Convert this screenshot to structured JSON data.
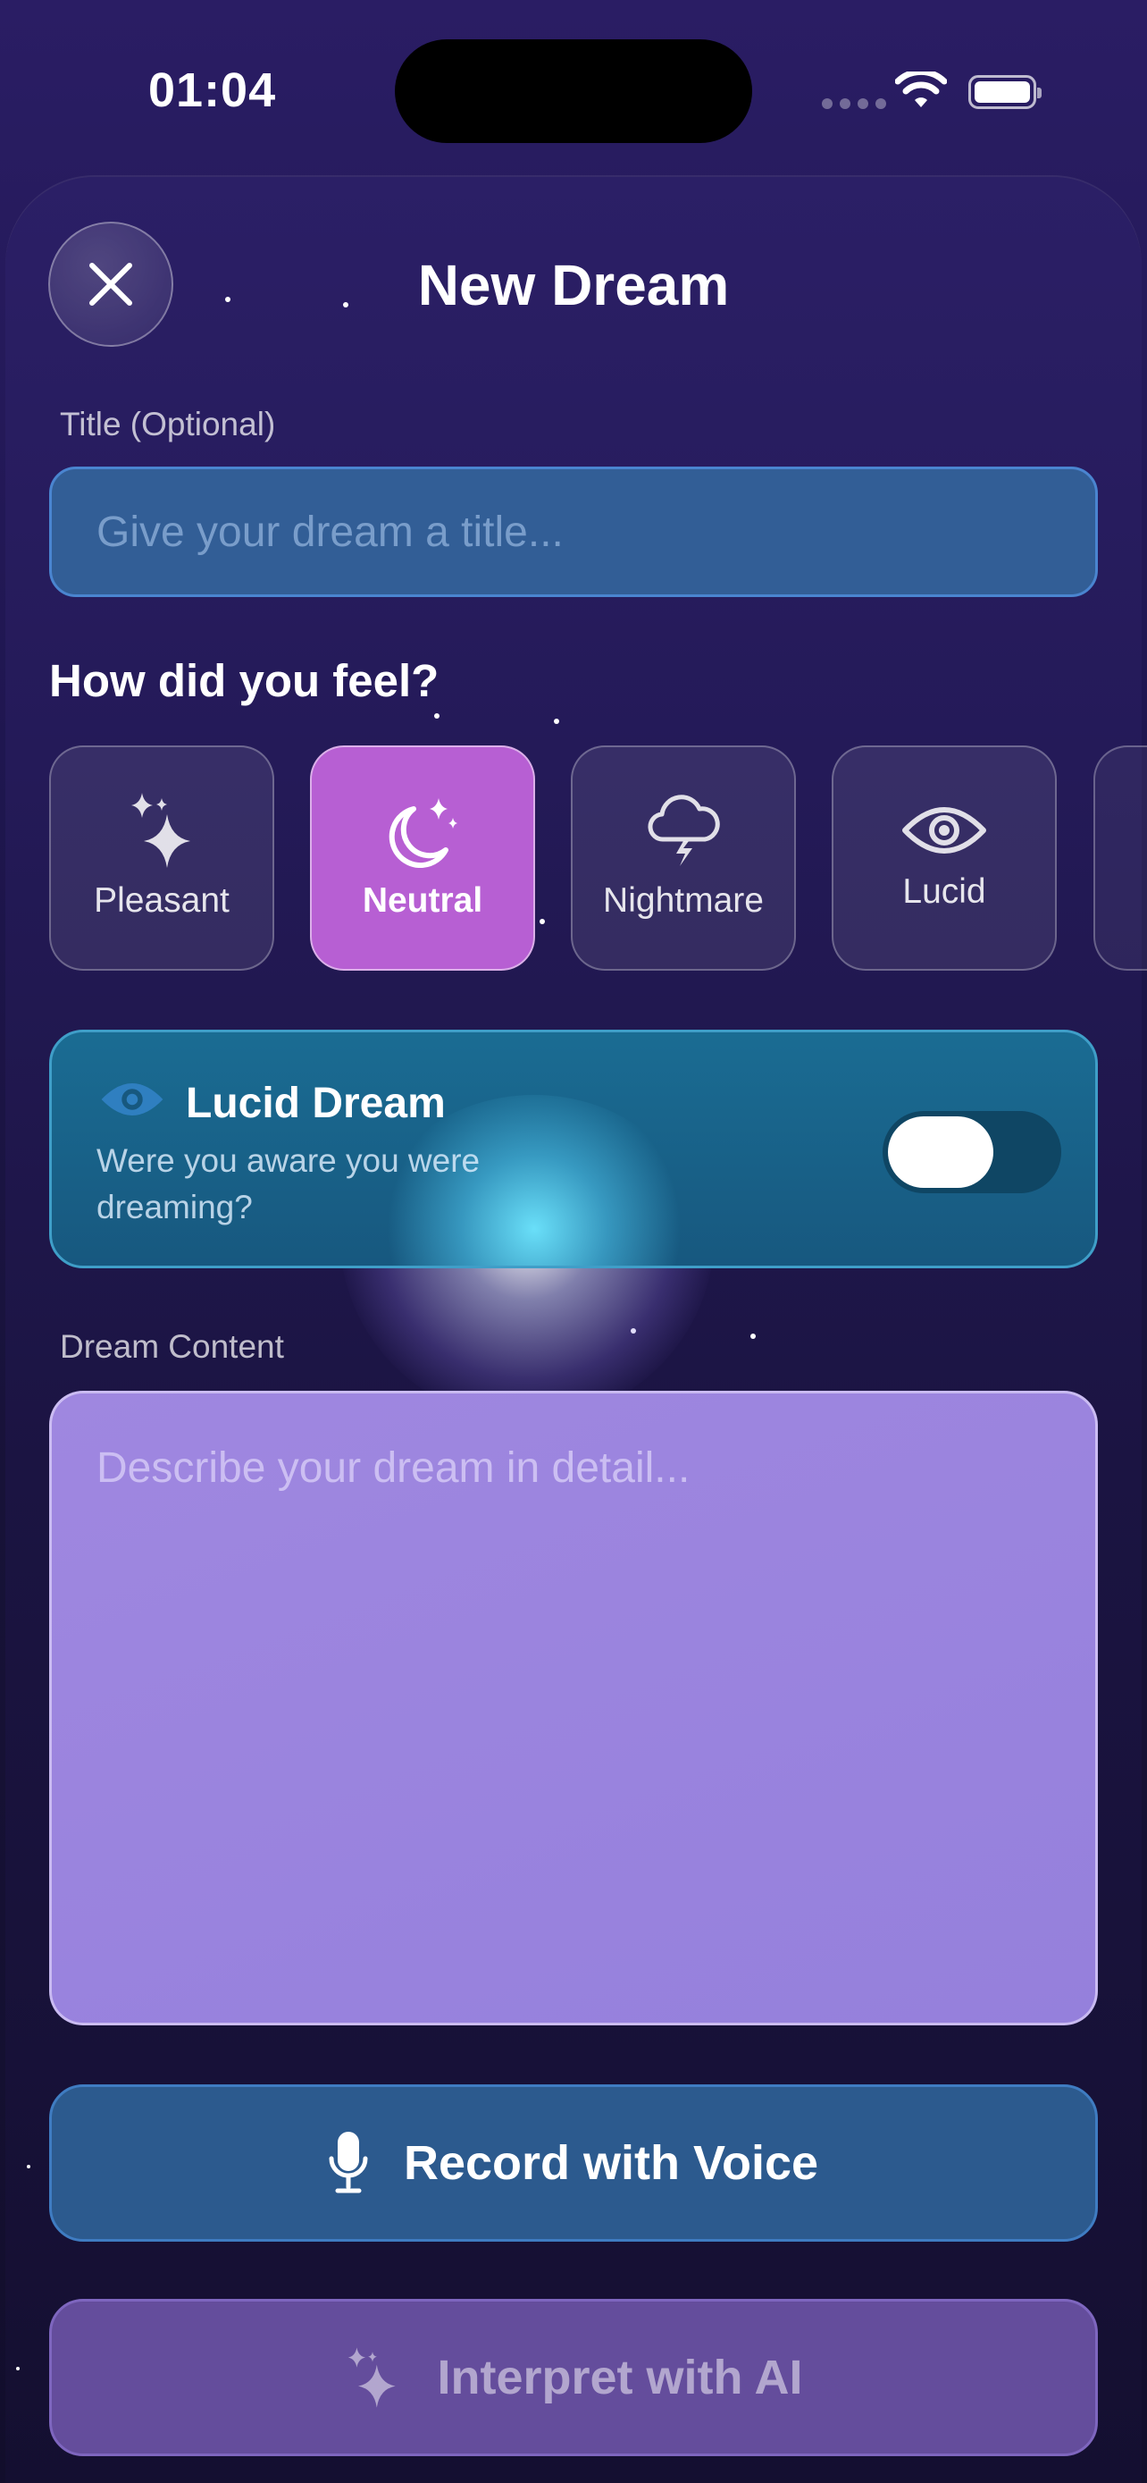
{
  "status_bar": {
    "time": "01:04"
  },
  "header": {
    "title": "New Dream"
  },
  "title_field": {
    "label": "Title (Optional)",
    "value": "",
    "placeholder": "Give your dream a title..."
  },
  "mood": {
    "heading": "How did you feel?",
    "selected": "Neutral",
    "options": [
      {
        "label": "Pleasant",
        "icon": "sparkles-icon"
      },
      {
        "label": "Neutral",
        "icon": "moon-stars-icon"
      },
      {
        "label": "Nightmare",
        "icon": "storm-cloud-icon"
      },
      {
        "label": "Lucid",
        "icon": "eye-icon"
      }
    ]
  },
  "lucid": {
    "title": "Lucid Dream",
    "subtitle": "Were you aware you were dreaming?",
    "enabled": false
  },
  "content_field": {
    "label": "Dream Content",
    "value": "",
    "placeholder": "Describe your dream in detail..."
  },
  "actions": {
    "record_label": "Record with Voice",
    "interpret_label": "Interpret with AI",
    "interpret_enabled": false
  },
  "colors": {
    "background": "#1f1650",
    "mood_selected": "#b75fd3",
    "lucid_card": "#1a6c93",
    "content_area": "#9f87e0",
    "record_button": "#2c5a8e",
    "interpret_button": "#644d9c"
  }
}
